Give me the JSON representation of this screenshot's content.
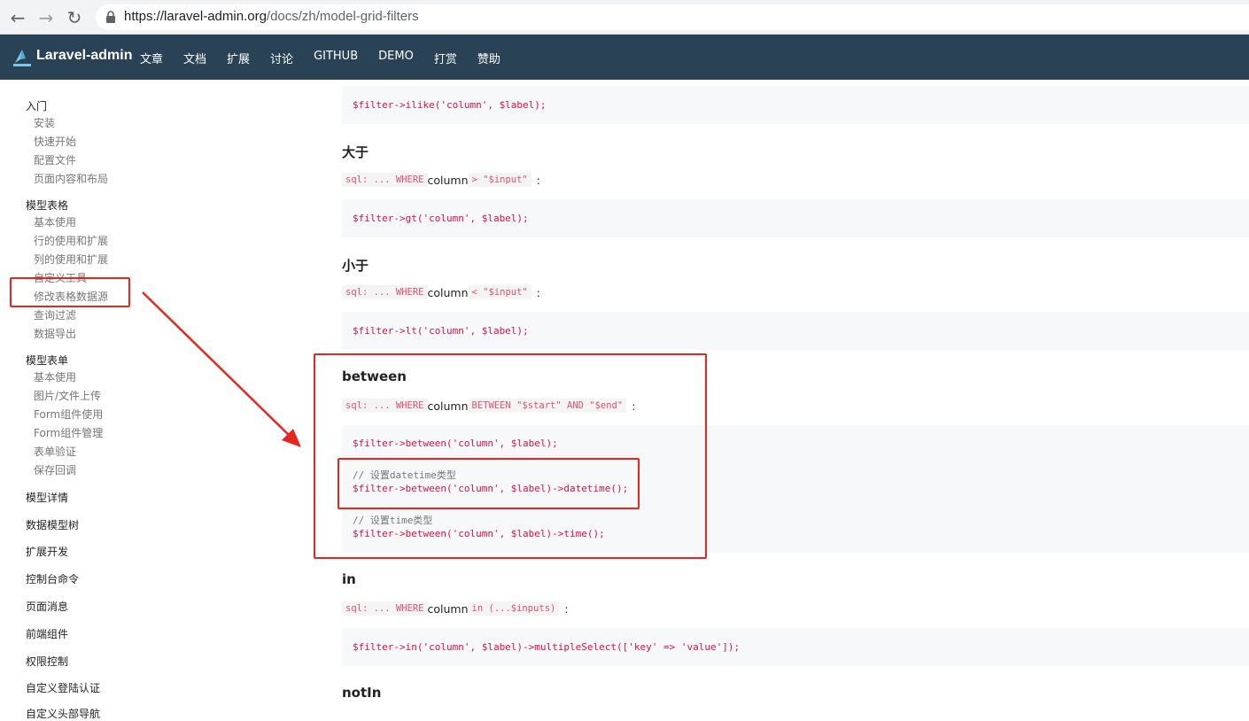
{
  "browser": {
    "url_host": "https://laravel-admin.org",
    "url_path": "/docs/zh/model-grid-filters"
  },
  "header": {
    "logo_text": "Laravel-admin",
    "nav": [
      "文章",
      "文档",
      "扩展",
      "讨论",
      "GITHUB",
      "DEMO",
      "打赏",
      "赞助"
    ]
  },
  "sidebar": {
    "items": [
      {
        "label": "入门",
        "sub": false
      },
      {
        "label": "安装",
        "sub": true
      },
      {
        "label": "快速开始",
        "sub": true
      },
      {
        "label": "配置文件",
        "sub": true
      },
      {
        "label": "页面内容和布局",
        "sub": true
      },
      {
        "label": "模型表格",
        "sub": false
      },
      {
        "label": "基本使用",
        "sub": true
      },
      {
        "label": "行的使用和扩展",
        "sub": true
      },
      {
        "label": "列的使用和扩展",
        "sub": true
      },
      {
        "label": "自定义工具",
        "sub": true
      },
      {
        "label": "修改表格数据源",
        "sub": true
      },
      {
        "label": "查询过滤",
        "sub": true
      },
      {
        "label": "数据导出",
        "sub": true
      },
      {
        "label": "模型表单",
        "sub": false
      },
      {
        "label": "基本使用",
        "sub": true
      },
      {
        "label": "图片/文件上传",
        "sub": true
      },
      {
        "label": "Form组件使用",
        "sub": true
      },
      {
        "label": "Form组件管理",
        "sub": true
      },
      {
        "label": "表单验证",
        "sub": true
      },
      {
        "label": "保存回调",
        "sub": true
      },
      {
        "label": "模型详情",
        "sub": false
      },
      {
        "label": "数据模型树",
        "sub": false
      },
      {
        "label": "扩展开发",
        "sub": false
      },
      {
        "label": "控制台命令",
        "sub": false
      },
      {
        "label": "页面消息",
        "sub": false
      },
      {
        "label": "前端组件",
        "sub": false
      },
      {
        "label": "权限控制",
        "sub": false
      },
      {
        "label": "自定义登陆认证",
        "sub": false
      },
      {
        "label": "自定义头部导航",
        "sub": false
      }
    ]
  },
  "content": {
    "ilike_code": "$filter->ilike('column', $label);",
    "gt": {
      "heading": "大于",
      "sql_prefix": "sql: ... WHERE",
      "sql_column": "column",
      "sql_op": "> \"$input\"",
      "sql_suffix": ":",
      "code": "$filter->gt('column', $label);"
    },
    "lt": {
      "heading": "小于",
      "sql_prefix": "sql: ... WHERE",
      "sql_column": "column",
      "sql_op": "< \"$input\"",
      "sql_suffix": ":",
      "code": "$filter->lt('column', $label);"
    },
    "between": {
      "heading": "between",
      "sql_prefix": "sql: ... WHERE",
      "sql_column": "column",
      "sql_op": "BETWEEN \"$start\" AND \"$end\"",
      "sql_suffix": ":",
      "code1": "$filter->between('column', $label);",
      "comment2": "// 设置datetime类型",
      "code2": "$filter->between('column', $label)->datetime();",
      "comment3": "// 设置time类型",
      "code3": "$filter->between('column', $label)->time();"
    },
    "in": {
      "heading": "in",
      "sql_prefix": "sql: ... WHERE",
      "sql_column": "column",
      "sql_op": "in (...$inputs)",
      "sql_suffix": ":",
      "code": "$filter->in('column', $label)->multipleSelect(['key' => 'value']);"
    },
    "notin": {
      "heading": "notIn"
    }
  },
  "colors": {
    "header_bg": "#2a4255",
    "annotation": "#e8251f",
    "code_bg": "#f6f8fa"
  }
}
